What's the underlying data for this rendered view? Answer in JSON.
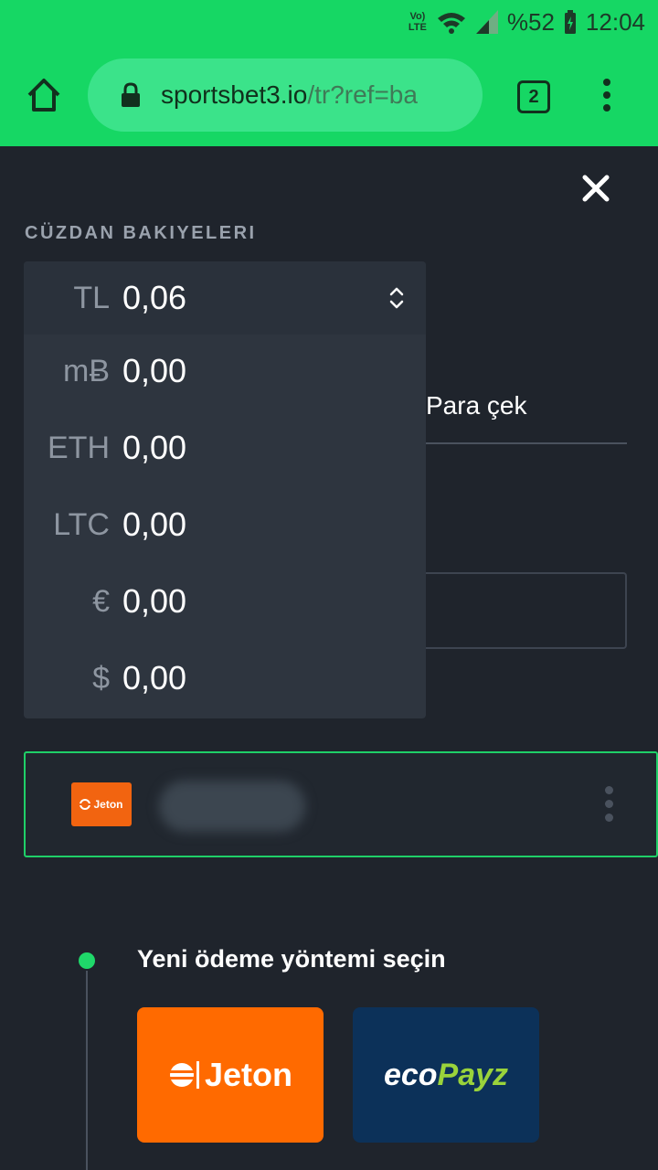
{
  "status_bar": {
    "network": "LTE",
    "volte": "Vo)",
    "battery": "%52",
    "time": "12:04"
  },
  "browser": {
    "url_domain": "sportsbet3.io",
    "url_path": "/tr?ref=ba",
    "tab_count": "2"
  },
  "wallet": {
    "heading": "CÜZDAN BAKIYELERI",
    "selected": {
      "code": "TL",
      "amount": "0,06"
    },
    "options": [
      {
        "code": "mɃ",
        "amount": "0,00"
      },
      {
        "code": "ETH",
        "amount": "0,00"
      },
      {
        "code": "LTC",
        "amount": "0,00"
      },
      {
        "code": "€",
        "amount": "0,00"
      },
      {
        "code": "$",
        "amount": "0,00"
      }
    ]
  },
  "tabs": {
    "withdraw": "Para çek"
  },
  "saved_method": {
    "logo_text": "Jeton"
  },
  "new_method": {
    "heading": "Yeni ödeme yöntemi seçin",
    "jeton": "Jeton",
    "ecopayz_eco": "eco",
    "ecopayz_payz": "Payz"
  },
  "colors": {
    "accent": "#16d764",
    "background": "#1f242c",
    "dropdown": "#2e353f",
    "jeton_orange": "#ff6a00",
    "ecopayz_blue": "#0c3159"
  }
}
